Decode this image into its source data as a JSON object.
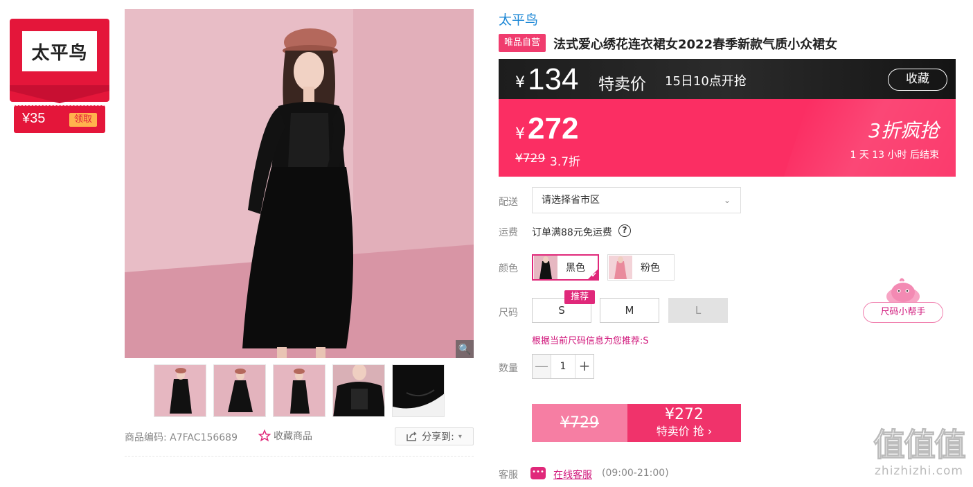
{
  "brand_badge": {
    "logo_text": "太平鸟",
    "coupon_amount": "¥35",
    "coupon_claim": "领取"
  },
  "gallery": {
    "sku_label": "商品编码:",
    "sku_code": "A7FAC156689",
    "favorite_label": "收藏商品",
    "share_label": "分享到:"
  },
  "product": {
    "brand_link": "太平鸟",
    "self_operated_tag": "唯品自营",
    "title": "法式爱心绣花连衣裙女2022春季新款气质小众裙女"
  },
  "flash_sale": {
    "yen": "¥",
    "price": "134",
    "label": "特卖价",
    "start_time": "15日10点开抢",
    "collect_label": "收藏"
  },
  "price_block": {
    "yen": "¥",
    "sale_price": "272",
    "original_price": "¥729",
    "discount": "3.7折",
    "promo_title": "3折疯抢",
    "countdown": "1 天 13 小时 后结束"
  },
  "delivery": {
    "label": "配送",
    "region_placeholder": "请选择省市区"
  },
  "shipping": {
    "label": "运费",
    "text": "订单满88元免运费",
    "help_icon": "?"
  },
  "color": {
    "label": "颜色",
    "options": [
      {
        "name": "黑色",
        "selected": true
      },
      {
        "name": "粉色",
        "selected": false
      }
    ]
  },
  "size": {
    "label": "尺码",
    "recommend_tag": "推荐",
    "options": [
      {
        "name": "S",
        "disabled": false
      },
      {
        "name": "M",
        "disabled": false
      },
      {
        "name": "L",
        "disabled": true
      }
    ],
    "recommend_text": "根据当前尺码信息为您推荐:S",
    "helper_label": "尺码小帮手"
  },
  "quantity": {
    "label": "数量",
    "minus": "—",
    "value": "1",
    "plus": "+"
  },
  "buy": {
    "original_price": "¥729",
    "price": "¥272",
    "action_label": "特卖价 抢 ›"
  },
  "service": {
    "label": "客服",
    "link_text": "在线客服",
    "hours": "(09:00-21:00)"
  },
  "watermark": {
    "big": "值值值",
    "small": "zhizhizhi.com"
  },
  "colors": {
    "accent_pink": "#fb2e63",
    "brand_red": "#e4163a",
    "link_blue": "#1e88d6",
    "magenta": "#e0287a"
  }
}
